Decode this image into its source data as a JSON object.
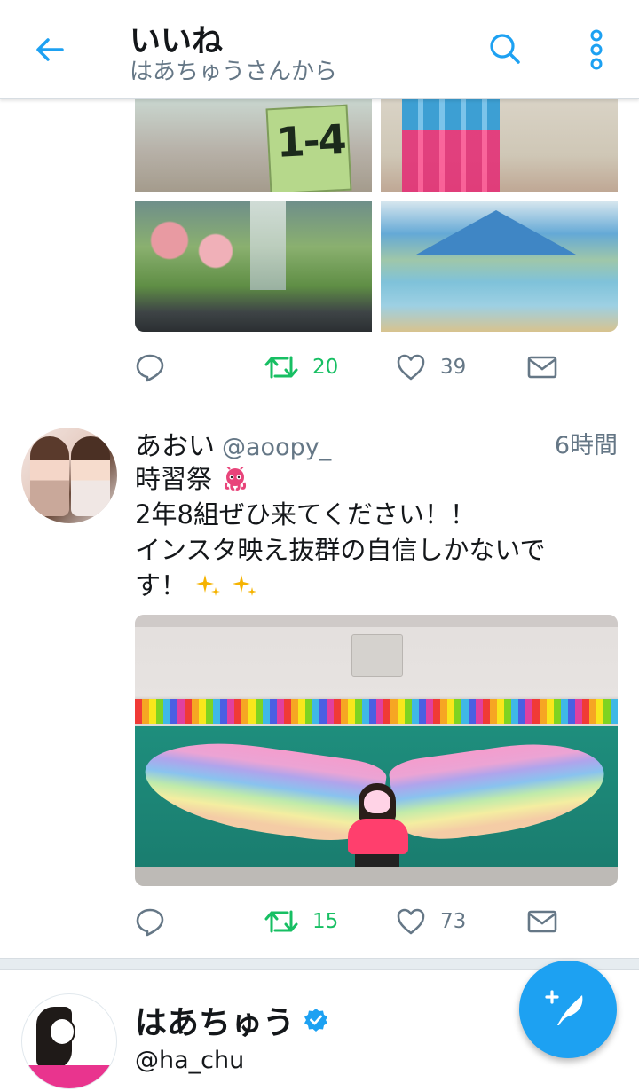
{
  "header": {
    "title": "いいね",
    "subtitle": "はあちゅうさんから"
  },
  "tweet1": {
    "image_sign_text": "1-4",
    "actions": {
      "retweets": "20",
      "likes": "39"
    }
  },
  "tweet2": {
    "name": "あおい",
    "handle": "@aoopy_",
    "time": "6時間",
    "text_lines": [
      "時習祭",
      "2年8組ぜひ来てください！！",
      "インスタ映え抜群の自信しかないで",
      "す！"
    ],
    "actions": {
      "retweets": "15",
      "likes": "73"
    }
  },
  "profile": {
    "name": "はあちゅう",
    "handle": "@ha_chu"
  },
  "colors": {
    "accent": "#1da1f2",
    "retweet_green": "#17bf63",
    "muted": "#657786"
  },
  "icons": [
    "back-arrow-icon",
    "search-icon",
    "more-vertical-icon",
    "reply-icon",
    "retweet-icon",
    "like-icon",
    "dm-icon",
    "verified-icon",
    "compose-icon"
  ]
}
